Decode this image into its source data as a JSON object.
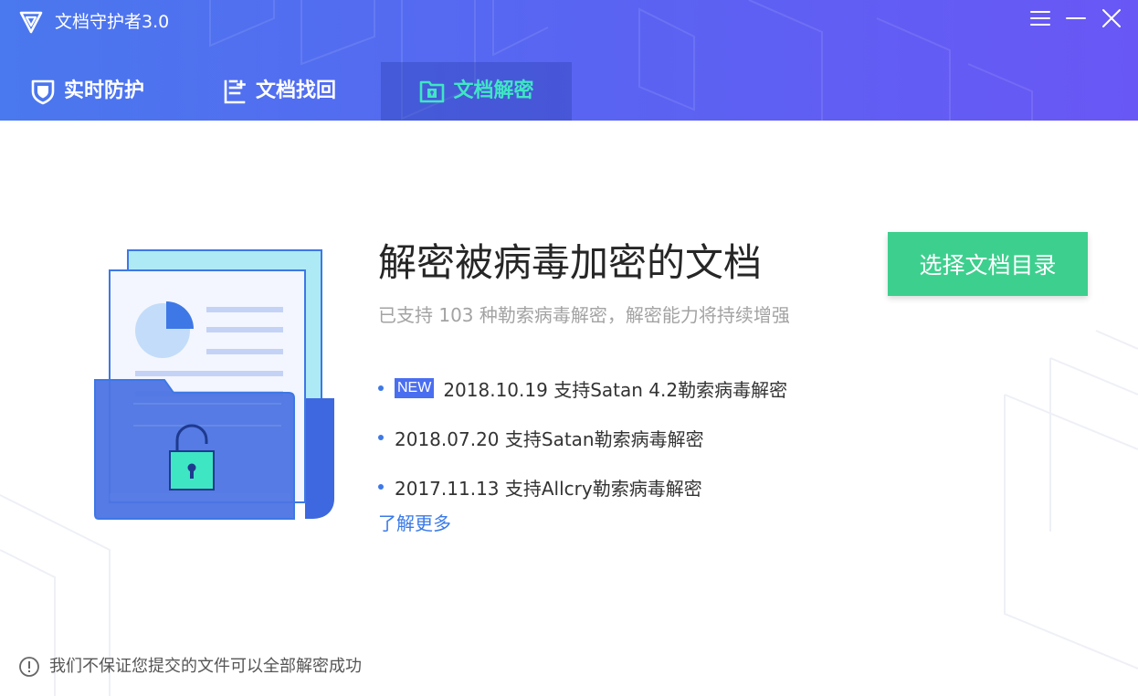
{
  "app": {
    "title": "文档守护者3.0"
  },
  "window_controls": {
    "menu_icon": "menu-icon",
    "minimize_icon": "minimize-icon",
    "close_icon": "close-icon"
  },
  "tabs": [
    {
      "label": "实时防护",
      "icon": "shield-icon",
      "active": false
    },
    {
      "label": "文档找回",
      "icon": "document-recover-icon",
      "active": false
    },
    {
      "label": "文档解密",
      "icon": "folder-lock-icon",
      "active": true
    }
  ],
  "main": {
    "title": "解密被病毒加密的文档",
    "subtitle": "已支持 103 种勒索病毒解密，解密能力将持续增强",
    "choose_button": "选择文档目录",
    "new_badge": "NEW",
    "updates": [
      {
        "text": "2018.10.19 支持Satan 4.2勒索病毒解密",
        "is_new": true
      },
      {
        "text": "2018.07.20 支持Satan勒索病毒解密",
        "is_new": false
      },
      {
        "text": "2017.11.13 支持Allcry勒索病毒解密",
        "is_new": false
      }
    ],
    "learn_more": "了解更多"
  },
  "footer": {
    "note": "我们不保证您提交的文件可以全部解密成功",
    "icon": "info-icon"
  },
  "colors": {
    "header_start": "#4a78ee",
    "header_end": "#6957f5",
    "active_tab_text": "#3fe6c4",
    "primary_button": "#3dcf8e",
    "link": "#3a7ae8",
    "badge": "#4a6ef0"
  }
}
